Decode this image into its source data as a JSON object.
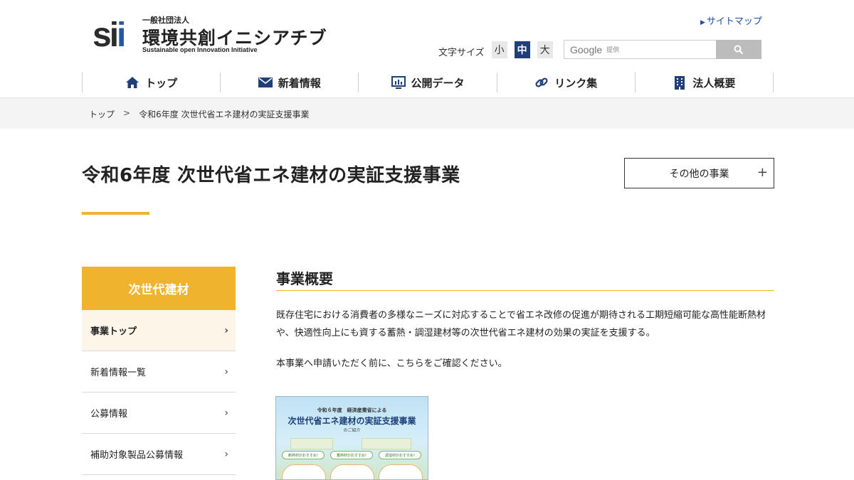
{
  "header": {
    "org_type": "一般社団法人",
    "logo_mark": "sii",
    "org_name": "環境共創イニシアチブ",
    "org_name_en": "Sustainable open Innovation Initiative",
    "sitemap_label": "サイトマップ",
    "font_size_label": "文字サイズ",
    "font_sizes": [
      "小",
      "中",
      "大"
    ],
    "search_brand": "Google",
    "search_suffix": "提供"
  },
  "nav": {
    "items": [
      {
        "label": "トップ",
        "icon": "home-icon"
      },
      {
        "label": "新着情報",
        "icon": "mail-icon"
      },
      {
        "label": "公開データ",
        "icon": "monitor-icon"
      },
      {
        "label": "リンク集",
        "icon": "link-icon"
      },
      {
        "label": "法人概要",
        "icon": "building-icon"
      }
    ]
  },
  "breadcrumb": {
    "home": "トップ",
    "separator": ">",
    "current": "令和6年度 次世代省エネ建材の実証支援事業"
  },
  "page": {
    "title": "令和6年度 次世代省エネ建材の実証支援事業",
    "other_projects": "その他の事業",
    "plus": "+"
  },
  "sidebar": {
    "heading": "次世代建材",
    "items": [
      {
        "label": "事業トップ",
        "active": true
      },
      {
        "label": "新着情報一覧",
        "active": false
      },
      {
        "label": "公募情報",
        "active": false
      },
      {
        "label": "補助対象製品公募情報",
        "active": false
      }
    ],
    "chevron": "›"
  },
  "main": {
    "section_title": "事業概要",
    "paragraph1": "既存住宅における消費者の多様なニーズに対応することで省エネ改修の促進が期待される工期短縮可能な高性能断熱材や、快適性向上にも資する蓄熱・調湿建材等の次世代省エネ建材の効果の実証を支援する。",
    "paragraph2": "本事業へ申請いただく前に、こちらをご確認ください。",
    "flyer": {
      "line1": "令和６年度　経済産業省による",
      "line2": "次世代省エネ建材の実証支援事業",
      "line3": "のご紹介",
      "pills": [
        "断熱材がおすすめ!",
        "蓄熱材がおすすめ!",
        "調湿材がおすすめ!"
      ]
    }
  },
  "colors": {
    "accent": "#f0b32e",
    "brand_blue": "#1e5aa8",
    "nav_dark": "#1e3f7a",
    "link": "#1a4fa3"
  }
}
